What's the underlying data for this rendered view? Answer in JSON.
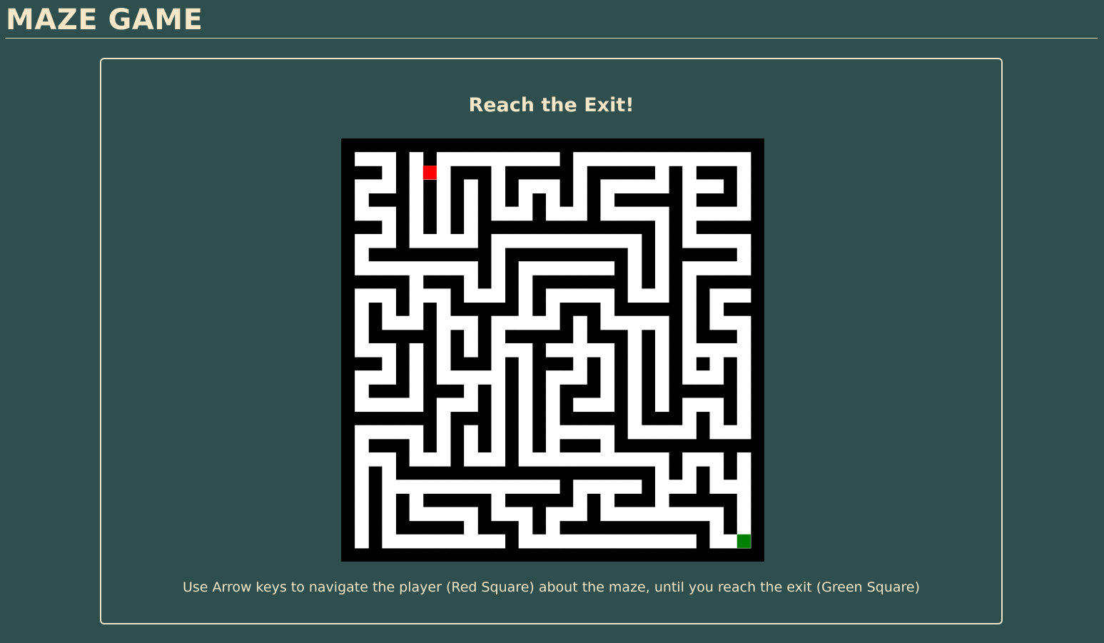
{
  "page": {
    "title": "MAZE GAME"
  },
  "game": {
    "heading": "Reach the Exit!",
    "instructions": "Use Arrow keys to navigate the player (Red Square) about the maze, until you reach the exit (Green Square)",
    "grid_size": 31,
    "player_cell": {
      "col": 6,
      "row": 2
    },
    "exit_cell": {
      "col": 29,
      "row": 29
    },
    "colors": {
      "background": "#2f4f4f",
      "wall": "#000000",
      "path": "#ffffff",
      "player": "#ff0000",
      "exit": "#008000"
    }
  }
}
